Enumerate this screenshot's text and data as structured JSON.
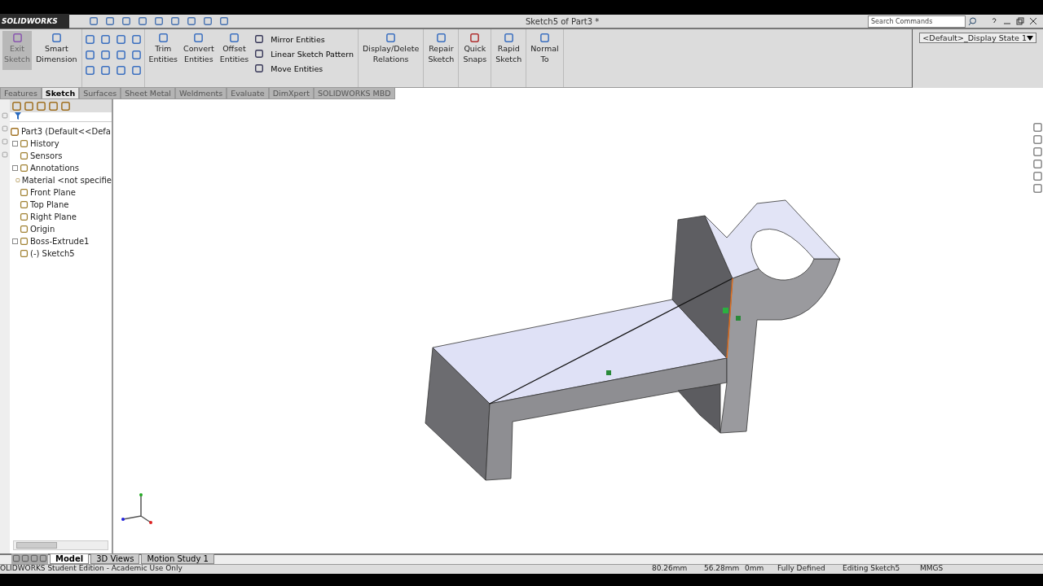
{
  "title_bar": {
    "logo": "SOLIDWORKS",
    "document_title": "Sketch5 of Part3 *",
    "search": {
      "placeholder": "Search Commands"
    }
  },
  "ribbon": {
    "large_buttons": [
      {
        "label": "Exit\nSketch",
        "selected": true
      },
      {
        "label": "Smart\nDimension",
        "selected": false
      }
    ],
    "tool_buttons": [
      {
        "label": "Trim\nEntities"
      },
      {
        "label": "Convert\nEntities"
      },
      {
        "label": "Offset\nEntities"
      }
    ],
    "list_buttons": [
      {
        "label": "Mirror Entities"
      },
      {
        "label": "Linear Sketch Pattern"
      },
      {
        "label": "Move Entities"
      }
    ],
    "right_buttons": [
      {
        "label": "Display/Delete\nRelations"
      },
      {
        "label": "Repair\nSketch"
      },
      {
        "label": "Quick\nSnaps"
      },
      {
        "label": "Rapid\nSketch"
      },
      {
        "label": "Normal\nTo"
      }
    ],
    "display_state": "<Default>_Display State 1"
  },
  "command_tabs": [
    {
      "label": "Features",
      "selected": false
    },
    {
      "label": "Sketch",
      "selected": true
    },
    {
      "label": "Surfaces",
      "selected": false
    },
    {
      "label": "Sheet Metal",
      "selected": false
    },
    {
      "label": "Weldments",
      "selected": false
    },
    {
      "label": "Evaluate",
      "selected": false
    },
    {
      "label": "DimXpert",
      "selected": false
    },
    {
      "label": "SOLIDWORKS MBD",
      "selected": false
    }
  ],
  "feature_tree": {
    "root": "Part3  (Default<<Defa",
    "items": [
      {
        "label": "History",
        "kind": "collapsed"
      },
      {
        "label": "Sensors",
        "kind": "leaf"
      },
      {
        "label": "Annotations",
        "kind": "collapsed"
      },
      {
        "label": "Material <not specifie",
        "kind": "leaf"
      },
      {
        "label": "Front Plane",
        "kind": "leaf"
      },
      {
        "label": "Top Plane",
        "kind": "leaf"
      },
      {
        "label": "Right Plane",
        "kind": "leaf"
      },
      {
        "label": "Origin",
        "kind": "leaf"
      },
      {
        "label": "Boss-Extrude1",
        "kind": "collapsed"
      },
      {
        "label": "(-) Sketch5",
        "kind": "leaf"
      }
    ]
  },
  "bottom_tabs": [
    {
      "label": "Model",
      "selected": true
    },
    {
      "label": "3D Views",
      "selected": false
    },
    {
      "label": "Motion Study 1",
      "selected": false
    }
  ],
  "status_bar": {
    "edition": "OLIDWORKS Student Edition - Academic Use Only",
    "x": "80.26mm",
    "y": "56.28mm",
    "z": "0mm",
    "sketch_state": "Fully Defined",
    "mode": "Editing Sketch5",
    "units": "MMGS"
  }
}
